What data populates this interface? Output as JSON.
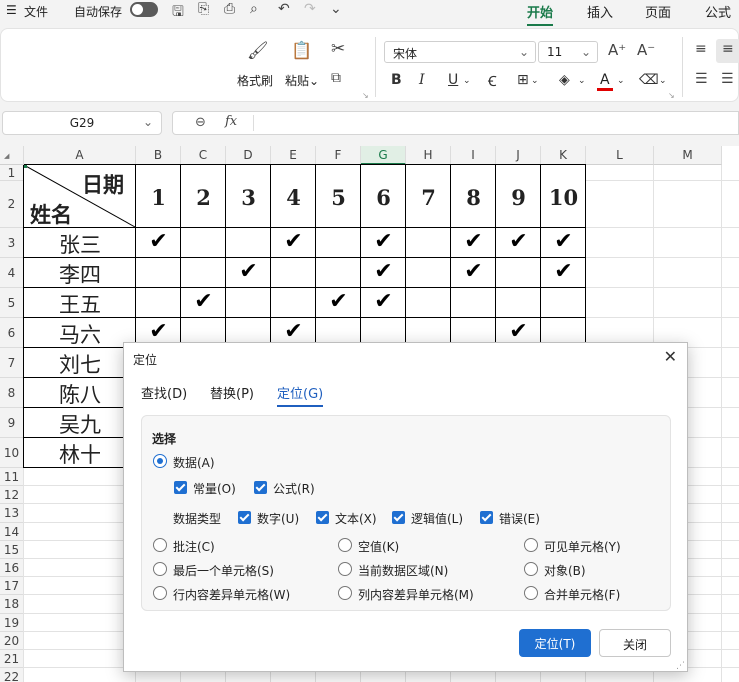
{
  "titlebar": {
    "menu_icon": "hamburger-icon",
    "file": "文件",
    "autosave": "自动保存",
    "tabs": [
      "开始",
      "插入",
      "页面",
      "公式"
    ],
    "active_tab": "开始"
  },
  "ribbon": {
    "format_painter": "格式刷",
    "paste": "粘贴",
    "paste_arrow": "⌄",
    "font_name": "宋体",
    "font_size": "11",
    "bold": "B",
    "italic": "I",
    "underline": "U"
  },
  "formula": {
    "cell_ref": "G29",
    "fx": "fx"
  },
  "sheet": {
    "columns": [
      "A",
      "B",
      "C",
      "D",
      "E",
      "F",
      "G",
      "H",
      "I",
      "J",
      "K",
      "L",
      "M"
    ],
    "selected_column": "G",
    "rows": [
      "1",
      "2",
      "3",
      "4",
      "5",
      "6",
      "7",
      "8",
      "9",
      "10",
      "11",
      "12",
      "13",
      "14",
      "15",
      "16",
      "17",
      "18",
      "19",
      "20",
      "21",
      "22"
    ],
    "header_date": "日期",
    "header_name": "姓名",
    "day_numbers": [
      "1",
      "2",
      "3",
      "4",
      "5",
      "6",
      "7",
      "8",
      "9",
      "10"
    ],
    "check_mark": "✔",
    "people": [
      {
        "name": "张三",
        "checks": [
          1,
          4,
          6,
          8,
          9,
          10
        ]
      },
      {
        "name": "李四",
        "checks": [
          3,
          6,
          8,
          10
        ]
      },
      {
        "name": "王五",
        "checks": [
          2,
          5,
          6
        ]
      },
      {
        "name": "马六",
        "checks": [
          1,
          4,
          9
        ]
      },
      {
        "name": "刘七",
        "checks": []
      },
      {
        "name": "陈八",
        "checks": []
      },
      {
        "name": "吴九",
        "checks": []
      },
      {
        "name": "林十",
        "checks": []
      }
    ]
  },
  "dialog": {
    "title": "定位",
    "close": "✕",
    "tabs": [
      "查找(D)",
      "替换(P)",
      "定位(G)"
    ],
    "active_tab": "定位(G)",
    "section": "选择",
    "data_option": "数据(A)",
    "constants": "常量(O)",
    "formulas": "公式(R)",
    "data_type_label": "数据类型",
    "types": [
      "数字(U)",
      "文本(X)",
      "逻辑值(L)",
      "错误(E)"
    ],
    "options": [
      [
        "批注(C)",
        "空值(K)",
        "可见单元格(Y)"
      ],
      [
        "最后一个单元格(S)",
        "当前数据区域(N)",
        "对象(B)"
      ],
      [
        "行内容差异单元格(W)",
        "列内容差异单元格(M)",
        "合并单元格(F)"
      ]
    ],
    "locate_button": "定位(T)",
    "close_button": "关闭"
  }
}
